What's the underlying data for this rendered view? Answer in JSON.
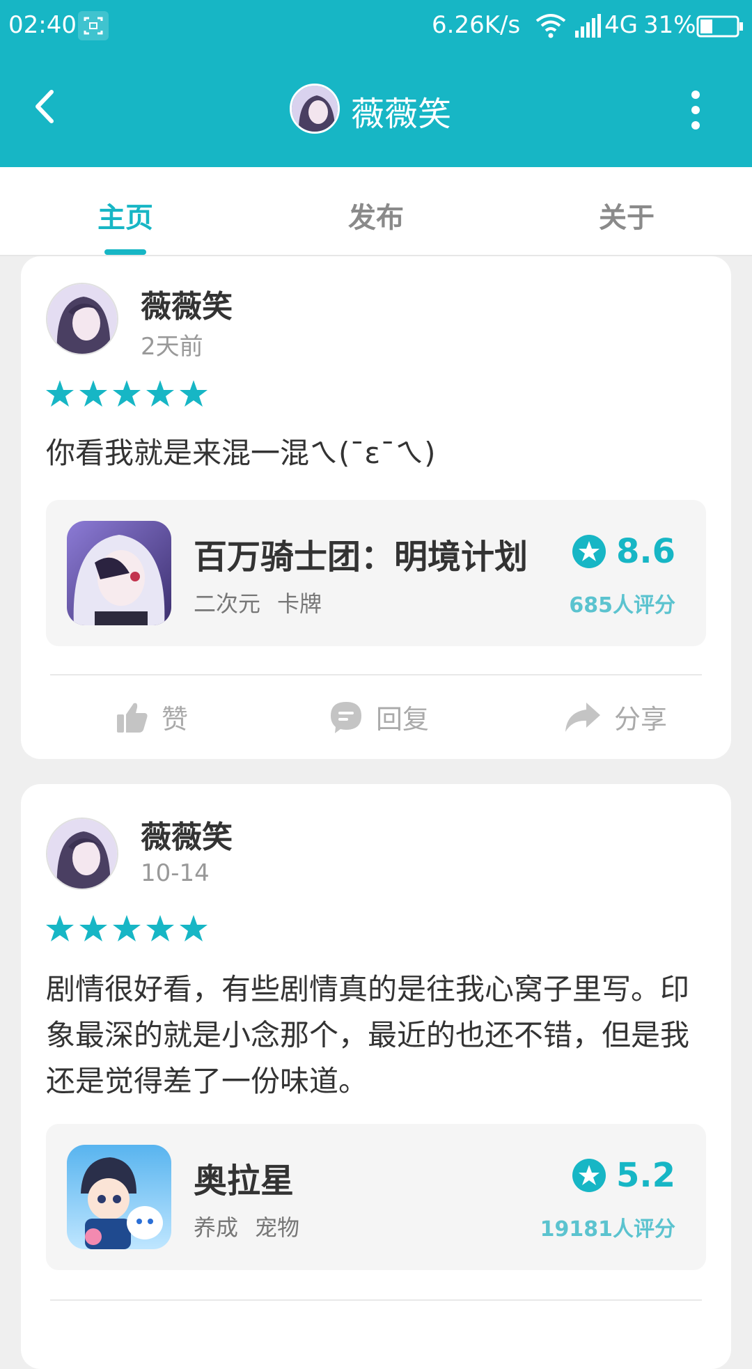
{
  "status_bar": {
    "time": "02:40",
    "speed": "6.26K/s",
    "network": "4G",
    "battery": "31%",
    "icons": [
      "screenshot-icon",
      "wifi-icon",
      "signal-icon",
      "battery-icon"
    ]
  },
  "header": {
    "title": "薇薇笑",
    "icons": [
      "back-icon",
      "more-icon"
    ]
  },
  "tabs": [
    {
      "label": "主页",
      "active": true
    },
    {
      "label": "发布",
      "active": false
    },
    {
      "label": "关于",
      "active": false
    }
  ],
  "reviews": [
    {
      "username": "薇薇笑",
      "time": "2天前",
      "stars": 5,
      "text": "你看我就是来混一混ㄟ(¯ε¯ㄟ)",
      "game": {
        "name": "百万骑士团：明境计划",
        "tags": [
          "二次元",
          "卡牌"
        ],
        "score": "8.6",
        "rating_count": "685人评分"
      },
      "actions": {
        "like": "赞",
        "reply": "回复",
        "share": "分享"
      }
    },
    {
      "username": "薇薇笑",
      "time": "10-14",
      "stars": 5,
      "text": "剧情很好看，有些剧情真的是往我心窝子里写。印象最深的就是小念那个，最近的也还不错，但是我还是觉得差了一份味道。",
      "game": {
        "name": "奥拉星",
        "tags": [
          "养成",
          "宠物"
        ],
        "score": "5.2",
        "rating_count": "19181人评分"
      }
    }
  ],
  "colors": {
    "accent": "#17b6c5",
    "background": "#efefef"
  }
}
